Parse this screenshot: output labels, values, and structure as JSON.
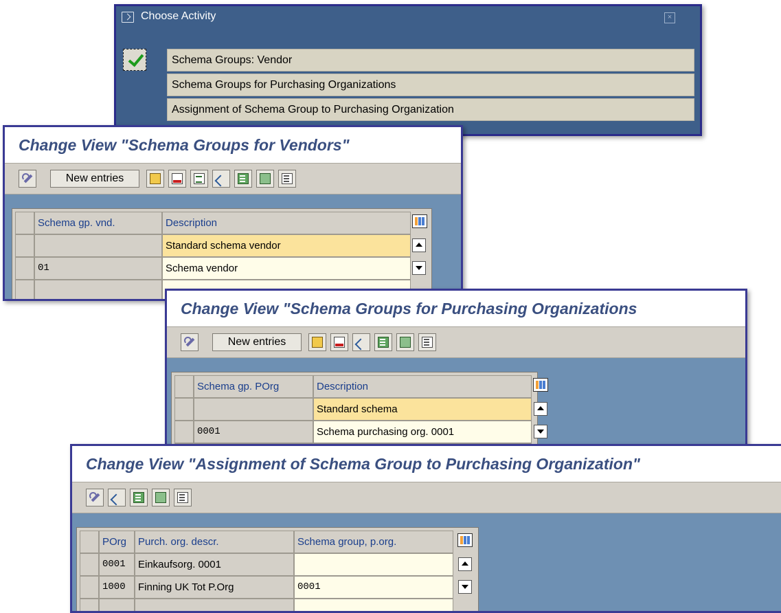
{
  "choose_activity": {
    "title": "Choose Activity",
    "close": "×",
    "activities": [
      "Schema Groups: Vendor",
      "Schema Groups for Purchasing Organizations",
      "Assignment of Schema Group to Purchasing Organization"
    ]
  },
  "vendor_view": {
    "title": "Change View \"Schema Groups for Vendors\"",
    "new_entries": "New entries",
    "headers": [
      "Schema gp. vnd.",
      "Description"
    ],
    "rows": [
      {
        "code": "",
        "description": "Standard schema vendor"
      },
      {
        "code": "01",
        "description": "Schema vendor"
      }
    ]
  },
  "porg_view": {
    "title": "Change View \"Schema Groups for Purchasing Organizations",
    "new_entries": "New entries",
    "headers": [
      "Schema gp. POrg",
      "Description"
    ],
    "rows": [
      {
        "code": "",
        "description": "Standard schema"
      },
      {
        "code": "0001",
        "description": "Schema purchasing org. 0001"
      }
    ]
  },
  "assign_view": {
    "title": "Change View \"Assignment of Schema Group to Purchasing Organization\"",
    "headers": [
      "POrg",
      "Purch. org. descr.",
      "Schema group, p.org."
    ],
    "rows": [
      {
        "porg": "0001",
        "descr": "Einkaufsorg. 0001",
        "schema": ""
      },
      {
        "porg": "1000",
        "descr": "Finning UK Tot P.Org",
        "schema": "0001"
      }
    ]
  }
}
